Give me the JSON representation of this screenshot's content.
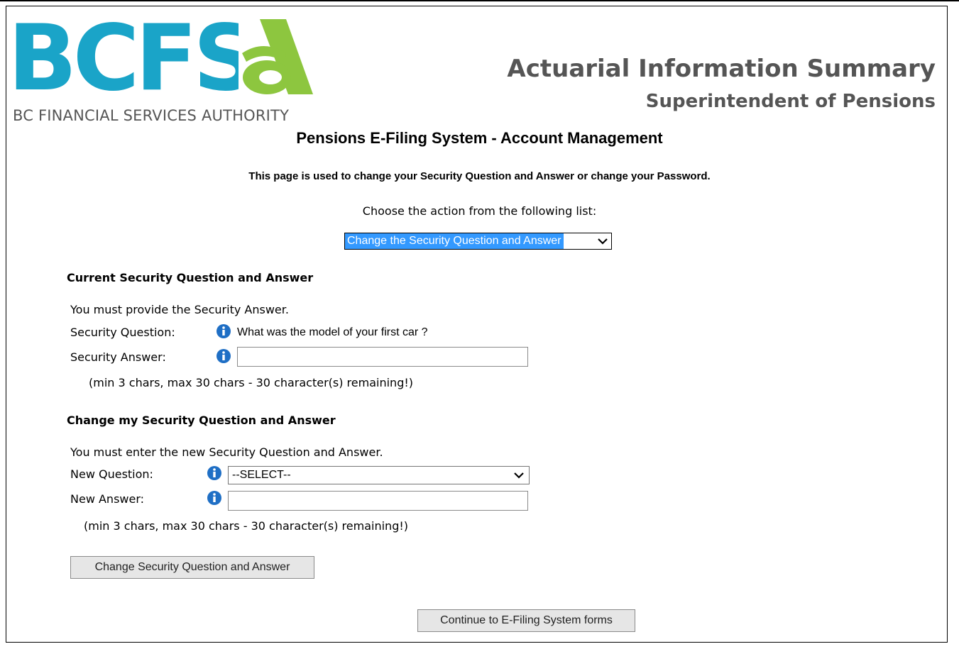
{
  "header": {
    "logo_text": "BCFSA",
    "logo_subtitle": "BC FINANCIAL SERVICES AUTHORITY",
    "title": "Actuarial Information Summary",
    "subtitle": "Superintendent of Pensions"
  },
  "page": {
    "system_title": "Pensions E-Filing System - Account Management",
    "description": "This page is used to change your Security Question and Answer or change your Password.",
    "choose_label": "Choose the action from the following list:",
    "action_selected": "Change the Security Question and Answer"
  },
  "current": {
    "heading": "Current Security Question and Answer",
    "instruction": "You must provide the Security Answer.",
    "question_label": "Security Question:",
    "question_value": "What was the model of your first car ?",
    "answer_label": "Security Answer:",
    "answer_value": "",
    "hint": "(min 3 chars, max 30 chars - 30 character(s) remaining!)"
  },
  "change": {
    "heading": "Change my Security Question and Answer",
    "instruction": "You must enter the new Security Question and Answer.",
    "question_label": "New Question:",
    "question_selected": "--SELECT--",
    "answer_label": "New Answer:",
    "answer_value": "",
    "hint": "(min 3 chars, max 30 chars - 30 character(s) remaining!)",
    "submit_label": "Change Security Question and Answer"
  },
  "footer": {
    "continue_label": "Continue to E-Filing System forms"
  },
  "colors": {
    "logo_blue": "#1aa4c8",
    "logo_green": "#8dc63f",
    "info_icon": "#1f6fc5",
    "select_highlight": "#3399ff"
  }
}
